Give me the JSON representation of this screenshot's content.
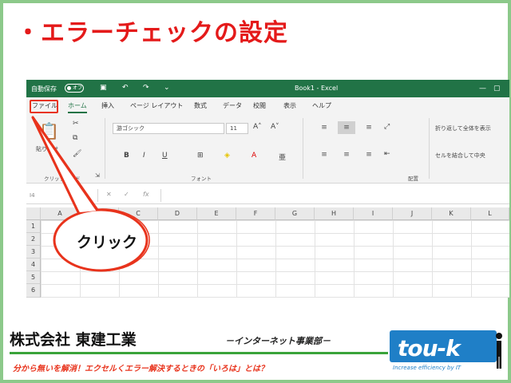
{
  "slide": {
    "title": "・エラーチェックの設定"
  },
  "excel": {
    "titlebar": {
      "autosave": "自動保存",
      "toggle": "オフ",
      "doc_title": "Book1 - Excel"
    },
    "tabs": [
      "ファイル",
      "ホーム",
      "挿入",
      "ページ レイアウト",
      "数式",
      "データ",
      "校閲",
      "表示",
      "ヘルプ"
    ],
    "active_tab": "ホーム",
    "ribbon": {
      "paste_label": "貼り付け",
      "clipboard_label": "クリップボード",
      "font_name": "游ゴシック",
      "font_size": "11",
      "font_group_label": "フォント",
      "wrap_text": "折り返して全体を表示",
      "merge_center": "セルを結合して中央",
      "alignment_label": "配置"
    },
    "name_box": "I4",
    "columns": [
      "A",
      "B",
      "C",
      "D",
      "E",
      "F",
      "G",
      "H",
      "I",
      "J",
      "K",
      "L"
    ],
    "rows": [
      "1",
      "2",
      "3",
      "4",
      "5",
      "6"
    ]
  },
  "callout": {
    "text": "クリック"
  },
  "footer": {
    "company": "株式会社 東建工業",
    "dept": "－インターネット事業部－",
    "tagline": "分から無いを解消！エクセルくエラー解決するときの「いろは」とは？",
    "logo_text": "tou-k",
    "logo_sub": "Increase efficiency by IT"
  },
  "colors": {
    "excel_green": "#217346",
    "title_red": "#e41a1a",
    "border_green": "#8cc98a",
    "logo_blue": "#1f7fc7",
    "highlight_red": "#e8331c"
  }
}
